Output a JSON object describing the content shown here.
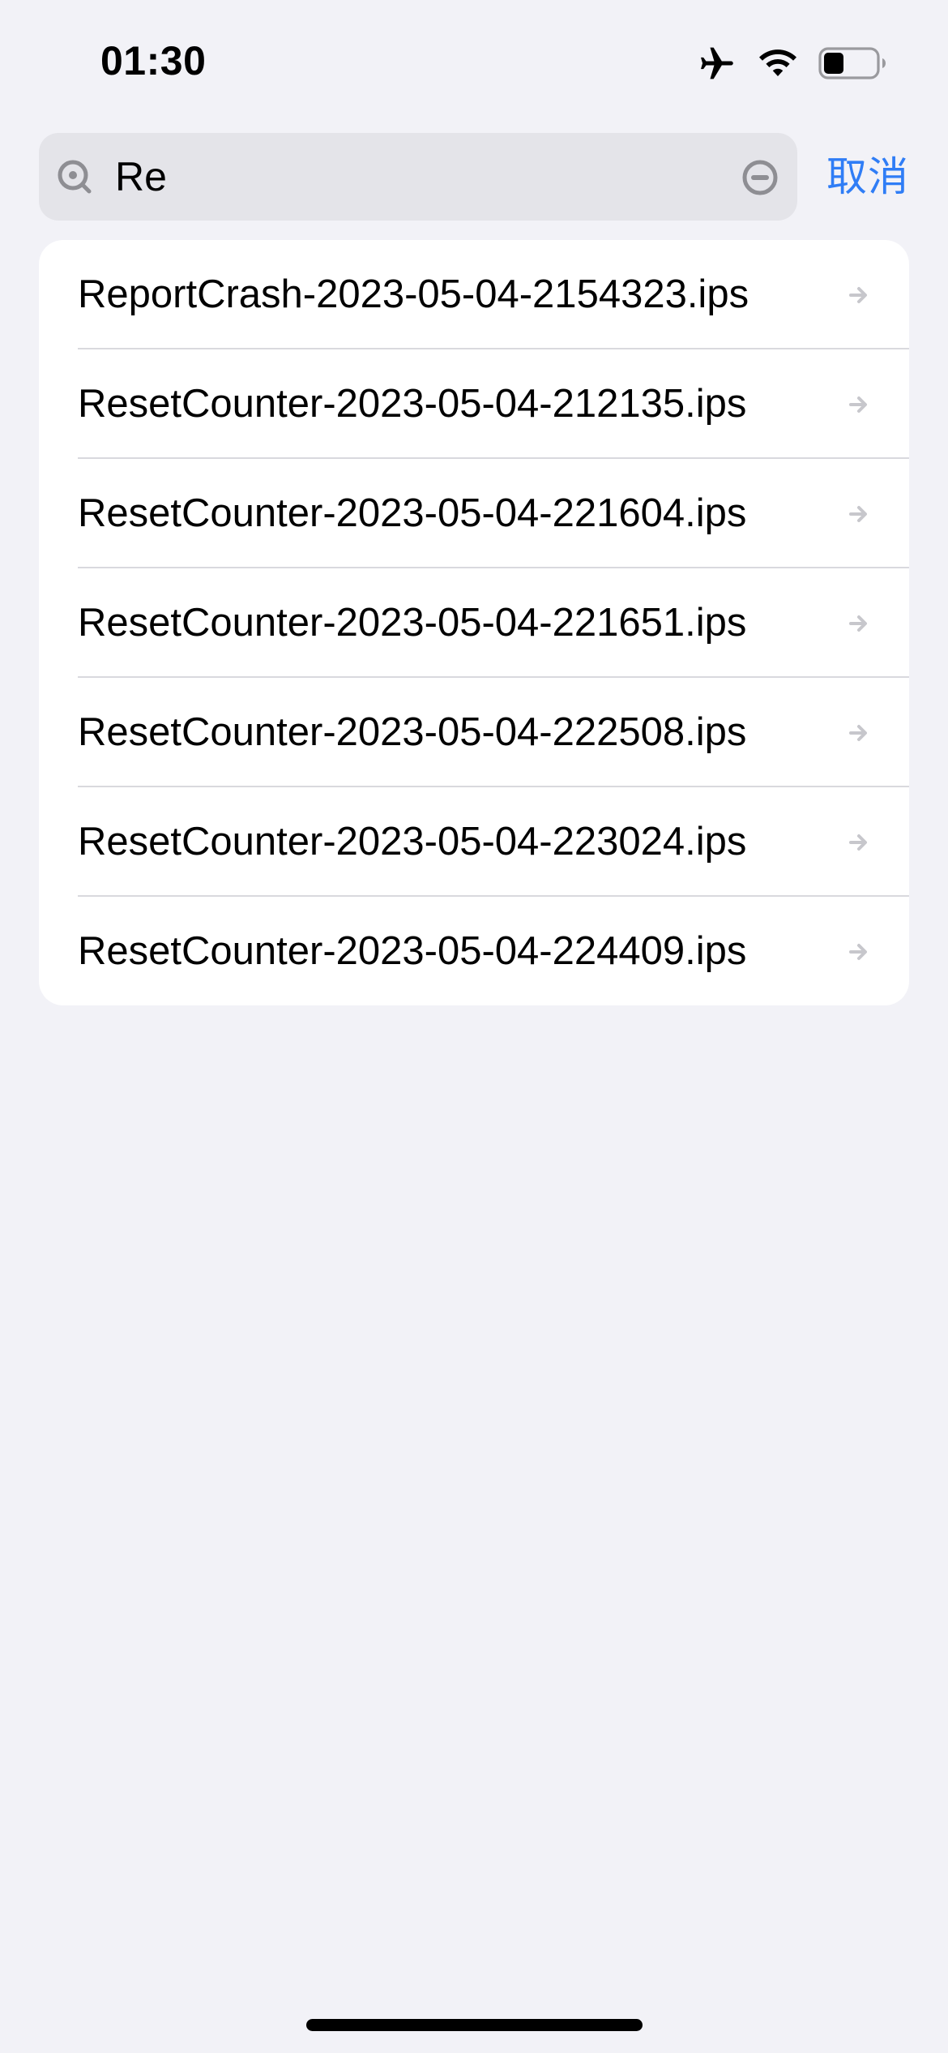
{
  "status_bar": {
    "time": "01:30",
    "icons": [
      "airplane-icon",
      "wifi-icon",
      "battery-icon"
    ]
  },
  "search": {
    "value": "Re",
    "cancel_label": "取消",
    "accent_color": "#2f7df6"
  },
  "results": [
    {
      "label": "ReportCrash-2023-05-04-2154323.ips"
    },
    {
      "label": "ResetCounter-2023-05-04-212135.ips"
    },
    {
      "label": "ResetCounter-2023-05-04-221604.ips"
    },
    {
      "label": "ResetCounter-2023-05-04-221651.ips"
    },
    {
      "label": "ResetCounter-2023-05-04-222508.ips"
    },
    {
      "label": "ResetCounter-2023-05-04-223024.ips"
    },
    {
      "label": "ResetCounter-2023-05-04-224409.ips"
    }
  ]
}
